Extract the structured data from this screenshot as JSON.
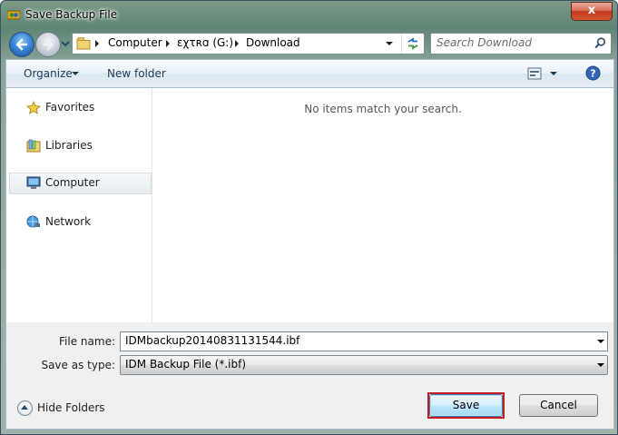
{
  "window": {
    "title": "Save Backup File",
    "close_label": "x"
  },
  "address": {
    "crumbs": [
      "Computer",
      "ɛχτʀɑ (G:)",
      "Download"
    ]
  },
  "search": {
    "placeholder": "Search Download"
  },
  "toolbar": {
    "organize_label": "Organize",
    "new_folder_label": "New folder"
  },
  "nav_pane": {
    "items": [
      {
        "label": "Favorites",
        "icon": "star-icon",
        "selected": false
      },
      {
        "label": "Libraries",
        "icon": "libraries-icon",
        "selected": false
      },
      {
        "label": "Computer",
        "icon": "computer-icon",
        "selected": true
      },
      {
        "label": "Network",
        "icon": "network-icon",
        "selected": false
      }
    ]
  },
  "content": {
    "empty_message": "No items match your search."
  },
  "form": {
    "file_name_label": "File name:",
    "file_name_value": "IDMbackup20140831131544.ibf",
    "save_as_type_label": "Save as type:",
    "save_as_type_value": "IDM Backup File (*.ibf)"
  },
  "footer": {
    "hide_folders_label": "Hide Folders",
    "save_label": "Save",
    "cancel_label": "Cancel"
  },
  "colors": {
    "highlight_outline": "#c41a1f",
    "toolbar_text": "#1e395b"
  }
}
